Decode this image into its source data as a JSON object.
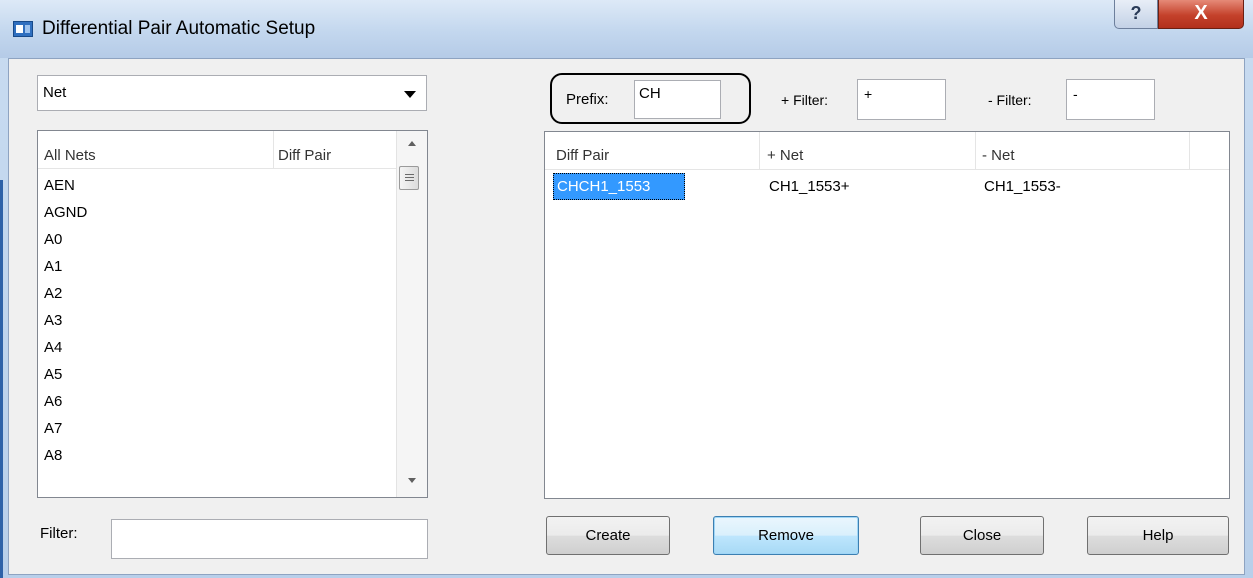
{
  "window": {
    "title": "Differential Pair Automatic Setup",
    "help_glyph": "?",
    "close_glyph": "X"
  },
  "left": {
    "combo_value": "Net",
    "list_headers": [
      "All Nets",
      "Diff Pair"
    ],
    "list_items": [
      "AEN",
      "AGND",
      "A0",
      "A1",
      "A2",
      "A3",
      "A4",
      "A5",
      "A6",
      "A7",
      "A8"
    ],
    "filter_label": "Filter:",
    "filter_value": ""
  },
  "right": {
    "prefix_label": "Prefix:",
    "prefix_value": "CH",
    "plus_filter_label": "+ Filter:",
    "plus_filter_value": "+",
    "minus_filter_label": "- Filter:",
    "minus_filter_value": "-",
    "table_headers": [
      "Diff Pair",
      "+ Net",
      "- Net"
    ],
    "rows": [
      {
        "diff_pair": "CHCH1_1553",
        "plus_net": "CH1_1553+",
        "minus_net": "CH1_1553-"
      }
    ]
  },
  "buttons": {
    "create": "Create",
    "remove": "Remove",
    "close": "Close",
    "help": "Help"
  },
  "colors": {
    "selection": "#3399ff",
    "focus_button": "#bee6fd",
    "title_bar": "#c3d7ee",
    "close_button": "#c4412b"
  }
}
